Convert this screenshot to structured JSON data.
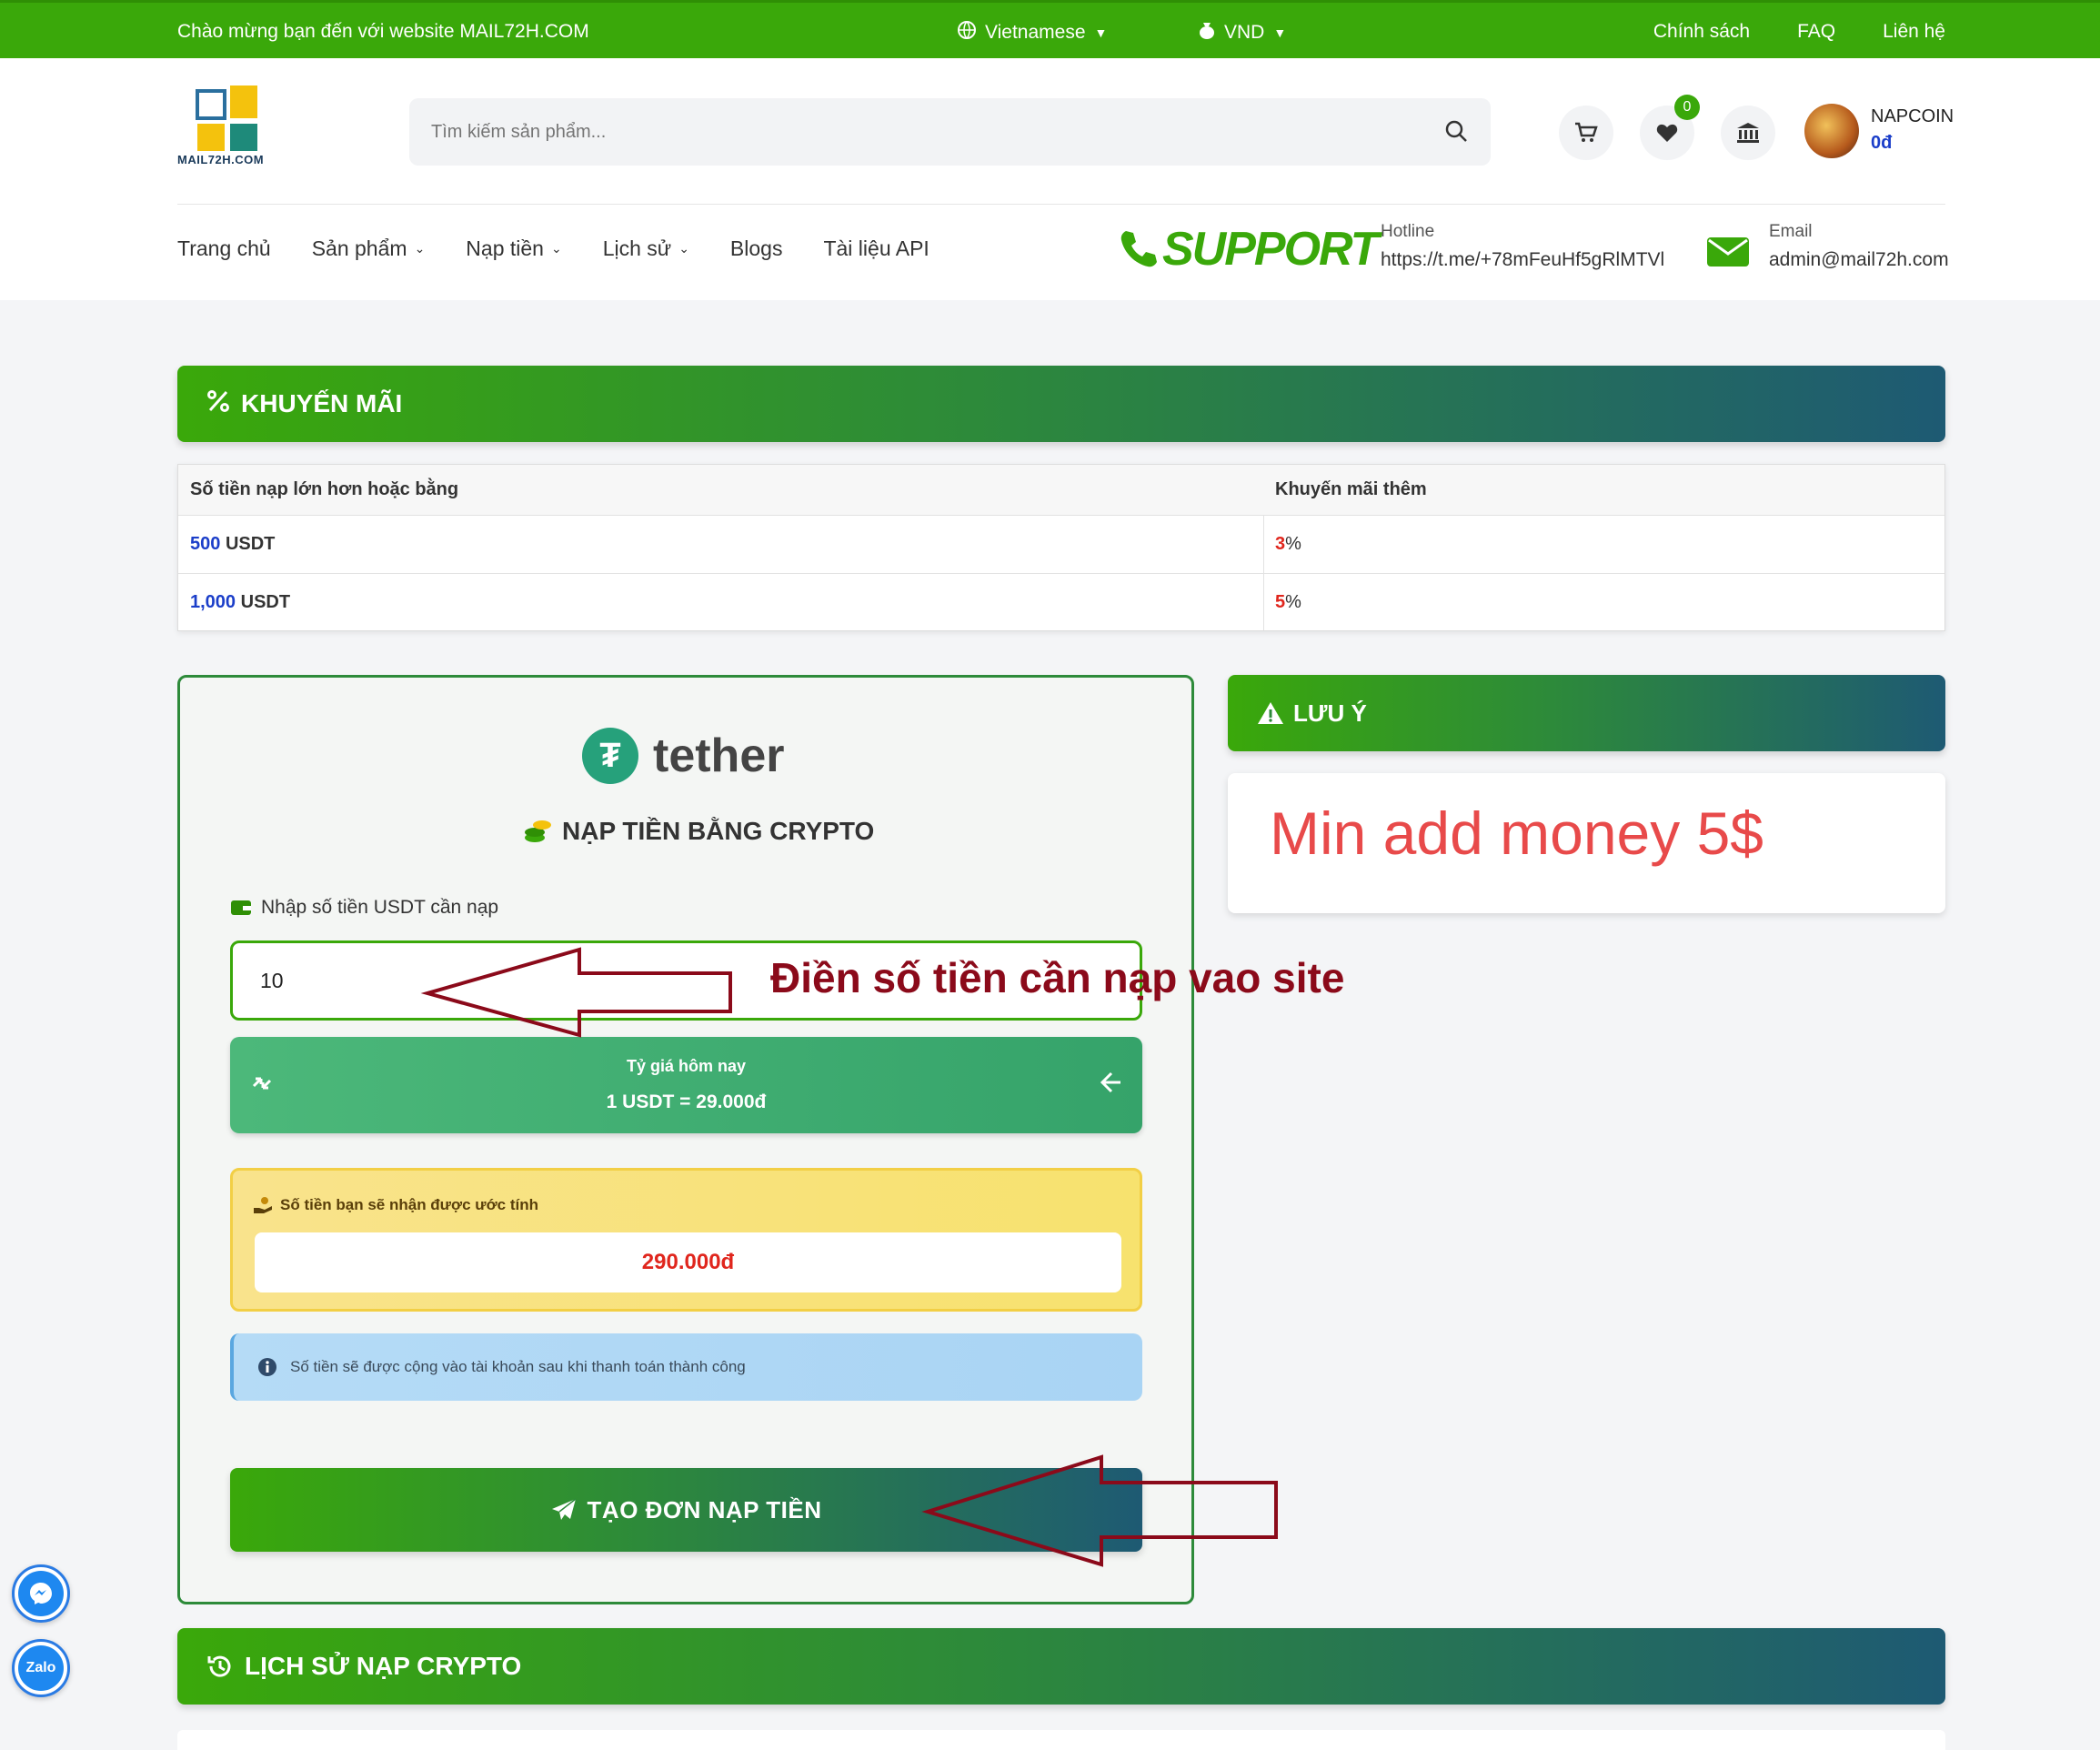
{
  "topbar": {
    "welcome": "Chào mừng bạn đến với website MAIL72H.COM",
    "language": "Vietnamese",
    "currency": "VND",
    "links": [
      "Chính sách",
      "FAQ",
      "Liên hệ"
    ]
  },
  "header": {
    "logo_text": "MAIL72H.COM",
    "search_placeholder": "Tìm kiếm sản phẩm...",
    "wishlist_count": "0",
    "user_name": "NAPCOIN",
    "user_balance": "0đ"
  },
  "nav": {
    "items": [
      {
        "label": "Trang chủ",
        "dropdown": false
      },
      {
        "label": "Sản phẩm",
        "dropdown": true
      },
      {
        "label": "Nạp tiền",
        "dropdown": true
      },
      {
        "label": "Lịch sử",
        "dropdown": true
      },
      {
        "label": "Blogs",
        "dropdown": false
      },
      {
        "label": "Tài liệu API",
        "dropdown": false
      }
    ],
    "support_text": "SUPPORT",
    "hotline_label": "Hotline",
    "hotline_value": "https://t.me/+78mFeuHf5gRlMTVl",
    "email_label": "Email",
    "email_value": "admin@mail72h.com"
  },
  "promo": {
    "title": "KHUYẾN MÃI",
    "col1": "Số tiền nạp lớn hơn hoặc bằng",
    "col2": "Khuyến mãi thêm",
    "rows": [
      {
        "amount": "500",
        "unit": "USDT",
        "bonus": "3",
        "pct": "%"
      },
      {
        "amount": "1,000",
        "unit": "USDT",
        "bonus": "5",
        "pct": "%"
      }
    ]
  },
  "deposit": {
    "brand": "tether",
    "title": "NẠP TIỀN BẰNG CRYPTO",
    "amount_label": "Nhập số tiền USDT cần nạp",
    "amount_value": "10",
    "rate_label": "Tỷ giá hôm nay",
    "rate_value": "1 USDT = 29.000đ",
    "receive_label": "Số tiền bạn sẽ nhận được ước tính",
    "receive_value": "290.000đ",
    "info_text": "Số tiền sẽ được cộng vào tài khoản sau khi thanh toán thành công",
    "submit_label": "TẠO ĐƠN NẠP TIỀN"
  },
  "note": {
    "title": "LƯU Ý",
    "message": "Min add money 5$"
  },
  "annotation": "Điền số tiền cần nạp vao site",
  "history": {
    "title": "LỊCH SỬ NẠP CRYPTO"
  },
  "floating": {
    "zalo_label": "Zalo"
  },
  "colors": {
    "primary_green": "#3aa80a",
    "gradient_end": "#1e5a73",
    "accent_red": "#e0261d",
    "accent_blue": "#1b3ec9",
    "annotation_arrow": "#8b0a1a"
  }
}
